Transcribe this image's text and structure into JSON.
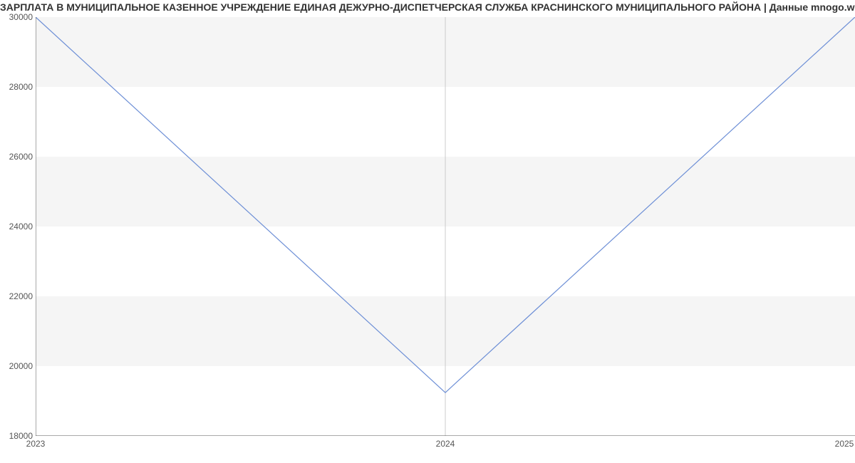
{
  "title": "ЗАРПЛАТА В МУНИЦИПАЛЬНОЕ КАЗЕННОЕ УЧРЕЖДЕНИЕ ЕДИНАЯ ДЕЖУРНО-ДИСПЕТЧЕРСКАЯ СЛУЖБА КРАСНИНСКОГО МУНИЦИПАЛЬНОГО РАЙОНА | Данные mnogo.work",
  "y_ticks": {
    "t0": "18000",
    "t1": "20000",
    "t2": "22000",
    "t3": "24000",
    "t4": "26000",
    "t5": "28000",
    "t6": "30000"
  },
  "x_ticks": {
    "t0": "2023",
    "t1": "2024",
    "t2": "2025"
  },
  "chart_data": {
    "type": "line",
    "title": "ЗАРПЛАТА В МУНИЦИПАЛЬНОЕ КАЗЕННОЕ УЧРЕЖДЕНИЕ ЕДИНАЯ ДЕЖУРНО-ДИСПЕТЧЕРСКАЯ СЛУЖБА КРАСНИНСКОГО МУНИЦИПАЛЬНОГО РАЙОНА | Данные mnogo.work",
    "xlabel": "",
    "ylabel": "",
    "x": [
      2023,
      2024,
      2025
    ],
    "values": [
      30000,
      19242,
      30000
    ],
    "ylim": [
      18000,
      30000
    ],
    "xlim": [
      2023,
      2025
    ],
    "y_ticks": [
      18000,
      20000,
      22000,
      24000,
      26000,
      28000,
      30000
    ],
    "x_ticks": [
      2023,
      2024,
      2025
    ],
    "grid": "horizontal-bands"
  }
}
